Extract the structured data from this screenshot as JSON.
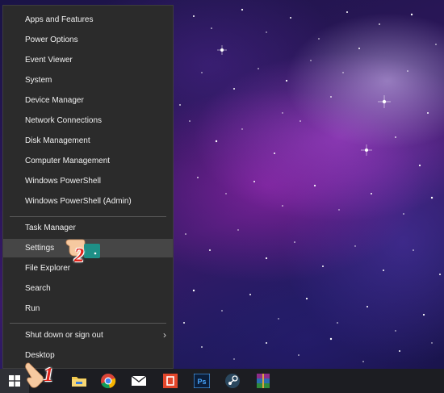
{
  "menu": {
    "group1": [
      "Apps and Features",
      "Power Options",
      "Event Viewer",
      "System",
      "Device Manager",
      "Network Connections",
      "Disk Management",
      "Computer Management",
      "Windows PowerShell",
      "Windows PowerShell (Admin)"
    ],
    "group2": [
      "Task Manager",
      "Settings",
      "File Explorer",
      "Search",
      "Run"
    ],
    "group3": [
      "Shut down or sign out",
      "Desktop"
    ]
  },
  "annotations": {
    "step1": "1",
    "step2": "2"
  },
  "taskbar": {
    "icons": [
      "windows-logo-icon",
      "file-explorer-icon",
      "chrome-icon",
      "mail-icon",
      "office-icon",
      "photoshop-icon",
      "steam-icon",
      "winrar-icon"
    ]
  },
  "colors": {
    "menu_bg": "#2b2b2b",
    "highlight": "#464646",
    "taskbar": "#1c1d22",
    "annotation": "#e0241b"
  }
}
